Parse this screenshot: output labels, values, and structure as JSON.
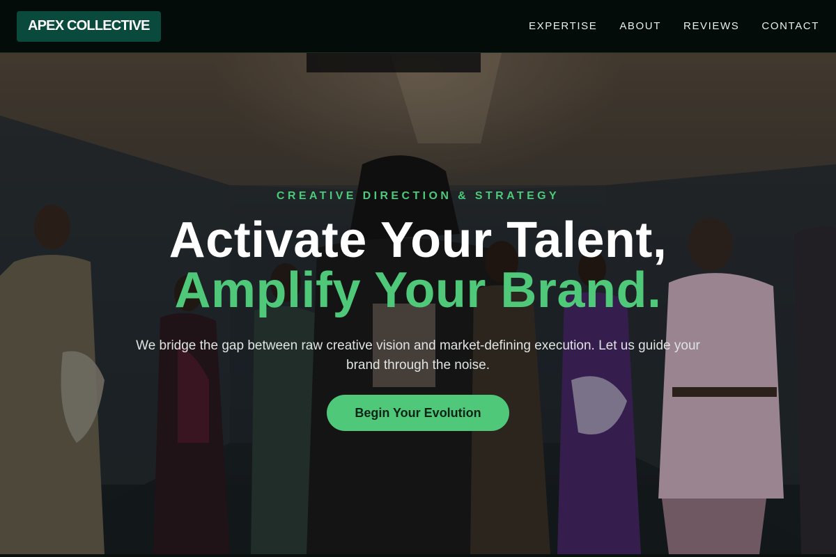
{
  "brand": {
    "name": "APEX COLLECTIVE"
  },
  "nav": {
    "items": [
      {
        "label": "EXPERTISE"
      },
      {
        "label": "ABOUT"
      },
      {
        "label": "REVIEWS"
      },
      {
        "label": "CONTACT"
      }
    ]
  },
  "hero": {
    "eyebrow": "CREATIVE DIRECTION & STRATEGY",
    "title_line1": "Activate Your Talent,",
    "title_line2": "Amplify Your Brand.",
    "subtitle": "We bridge the gap between raw creative vision and market-defining execution. Let us guide your brand through the noise.",
    "cta_label": "Begin Your Evolution"
  },
  "colors": {
    "accent": "#4fc879",
    "header_bg": "#040c0a",
    "logo_bg": "#0a4a3c"
  }
}
